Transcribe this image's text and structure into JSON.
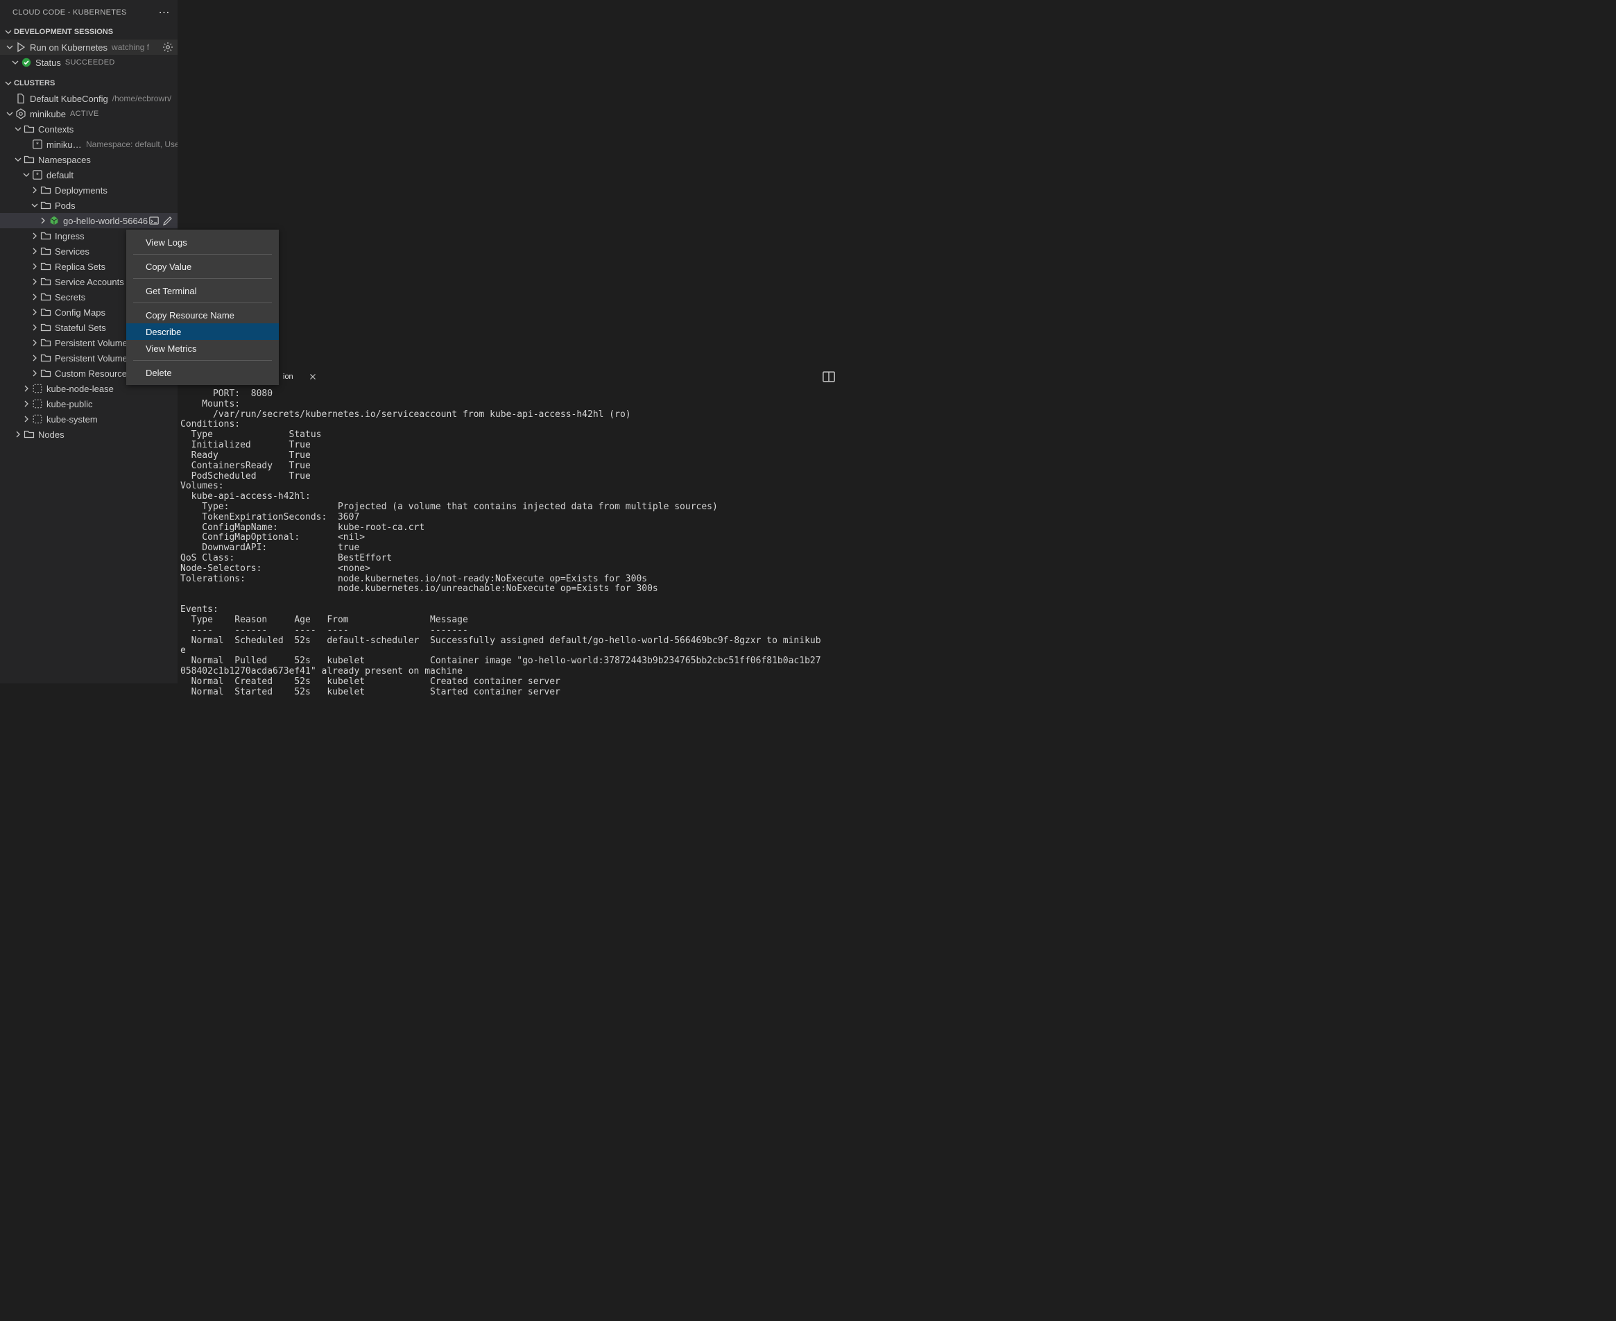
{
  "header": {
    "title": "CLOUD CODE - KUBERNETES"
  },
  "sections": {
    "dev": {
      "title": "DEVELOPMENT SESSIONS",
      "run": {
        "label": "Run on Kubernetes",
        "desc": "watching f"
      },
      "status": {
        "label": "Status",
        "desc": "SUCCEEDED"
      }
    },
    "clusters": {
      "title": "CLUSTERS",
      "kubeconfig": {
        "label": "Default KubeConfig",
        "desc": "/home/ecbrown/"
      },
      "minikube": {
        "label": "minikube",
        "desc": "ACTIVE"
      },
      "contexts": {
        "label": "Contexts"
      },
      "mk_ctx": {
        "label": "minikube",
        "desc": "Namespace: default, Use"
      },
      "namespaces": {
        "label": "Namespaces"
      },
      "ns_default": {
        "label": "default"
      },
      "deployments": {
        "label": "Deployments"
      },
      "pods": {
        "label": "Pods"
      },
      "pod_item": {
        "label": "go-hello-world-56646"
      },
      "ingress": {
        "label": "Ingress"
      },
      "services": {
        "label": "Services"
      },
      "replica_sets": {
        "label": "Replica Sets"
      },
      "service_accounts": {
        "label": "Service Accounts"
      },
      "secrets": {
        "label": "Secrets"
      },
      "config_maps": {
        "label": "Config Maps"
      },
      "stateful_sets": {
        "label": "Stateful Sets"
      },
      "pv": {
        "label": "Persistent Volumes"
      },
      "pvc": {
        "label": "Persistent Volume"
      },
      "crd": {
        "label": "Custom Resource Definitions"
      },
      "ns_knl": {
        "label": "kube-node-lease"
      },
      "ns_kp": {
        "label": "kube-public"
      },
      "ns_ks": {
        "label": "kube-system"
      },
      "nodes": {
        "label": "Nodes"
      }
    }
  },
  "context_menu": {
    "items": [
      "View Logs",
      "Copy Value",
      "Get Terminal",
      "Copy Resource Name",
      "Describe",
      "View Metrics",
      "Delete"
    ],
    "selected": "Describe"
  },
  "panel": {
    "tab_fragment": "ion",
    "output": "      PORT:  8080\n    Mounts:\n      /var/run/secrets/kubernetes.io/serviceaccount from kube-api-access-h42hl (ro)\nConditions:\n  Type              Status\n  Initialized       True\n  Ready             True\n  ContainersReady   True\n  PodScheduled      True\nVolumes:\n  kube-api-access-h42hl:\n    Type:                    Projected (a volume that contains injected data from multiple sources)\n    TokenExpirationSeconds:  3607\n    ConfigMapName:           kube-root-ca.crt\n    ConfigMapOptional:       <nil>\n    DownwardAPI:             true\nQoS Class:                   BestEffort\nNode-Selectors:              <none>\nTolerations:                 node.kubernetes.io/not-ready:NoExecute op=Exists for 300s\n                             node.kubernetes.io/unreachable:NoExecute op=Exists for 300s\n\nEvents:\n  Type    Reason     Age   From               Message\n  ----    ------     ----  ----               -------\n  Normal  Scheduled  52s   default-scheduler  Successfully assigned default/go-hello-world-566469bc9f-8gzxr to minikub\ne\n  Normal  Pulled     52s   kubelet            Container image \"go-hello-world:37872443b9b234765bb2cbc51ff06f81b0ac1b27\n058402c1b1270acda673ef41\" already present on machine\n  Normal  Created    52s   kubelet            Created container server\n  Normal  Started    52s   kubelet            Started container server"
  }
}
